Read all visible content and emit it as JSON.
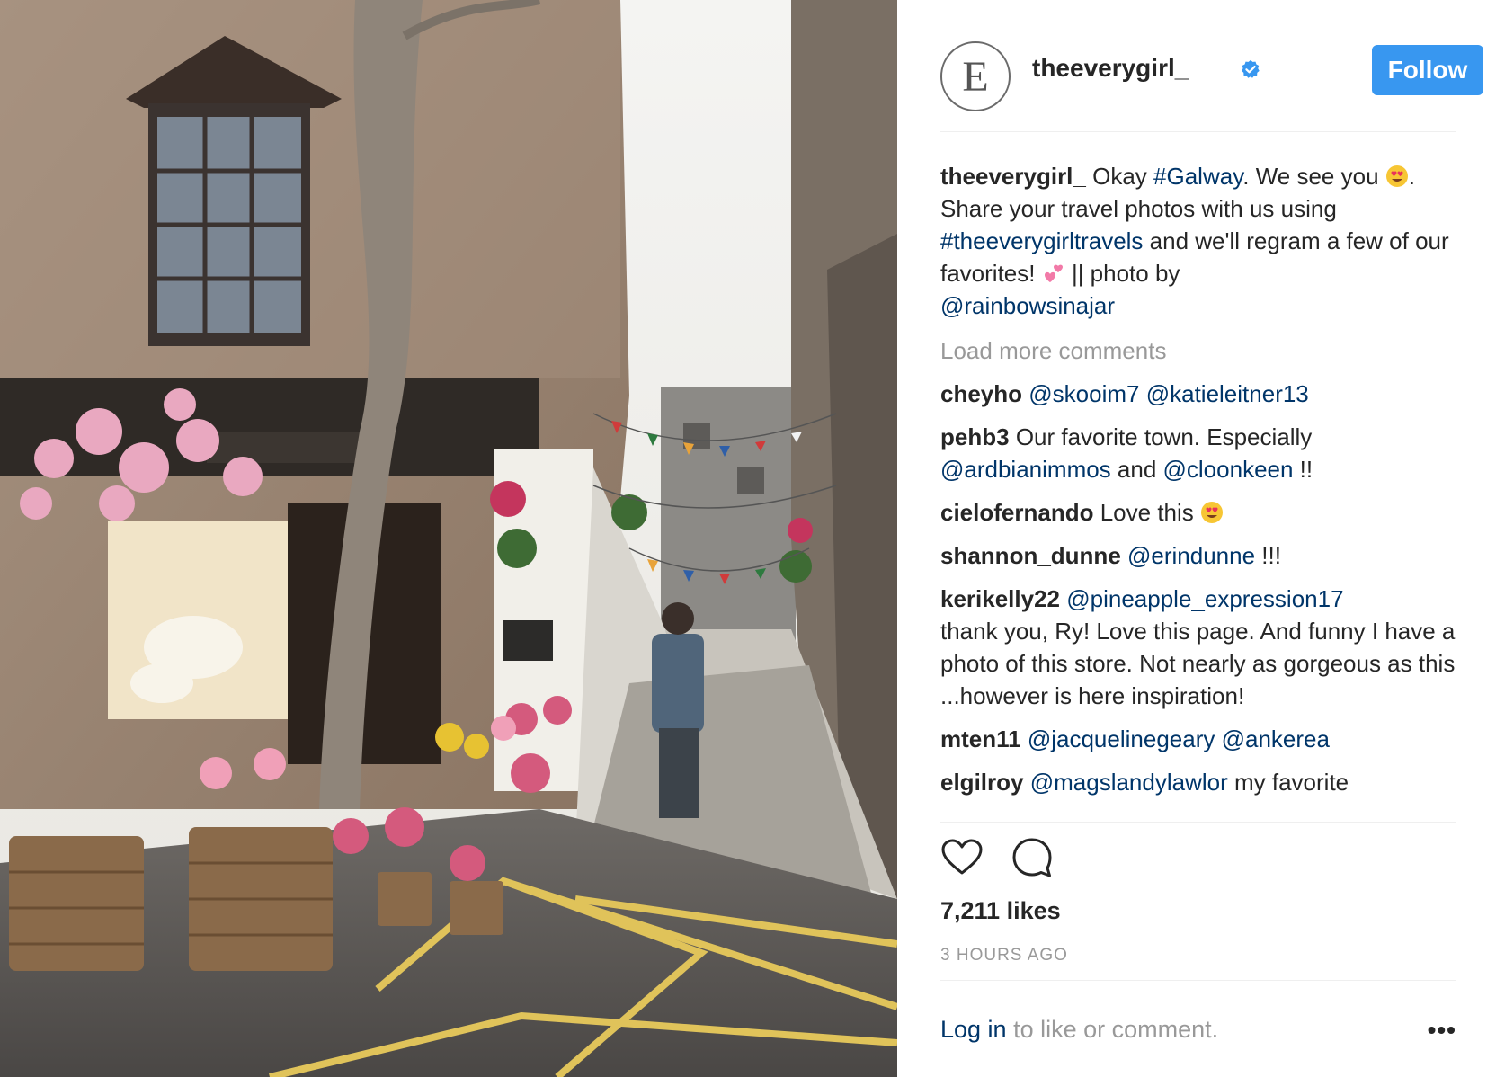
{
  "post": {
    "username": "theeverygirl_",
    "avatar_letter": "E",
    "follow_label": "Follow",
    "caption": {
      "user": "theeverygirl_",
      "parts": [
        "Okay ",
        "#Galway",
        ". We see you ",
        ". Share your travel photos with us using ",
        "#theeverygirltravels",
        " and we'll regram a few of our favorites! ",
        " || photo by ",
        "@rainbowsinajar"
      ]
    },
    "load_more": "Load more comments",
    "comments": [
      {
        "user": "cheyho",
        "tags": [
          "@skooim7",
          "@katieleitner13"
        ]
      },
      {
        "user": "pehb3",
        "text1": "Our favorite town. Especially ",
        "tag1": "@ardbianimmos",
        "text2": " and ",
        "tag2": "@cloonkeen",
        "text3": " !!"
      },
      {
        "user": "cielofernando",
        "text": "Love this "
      },
      {
        "user": "shannon_dunne",
        "tag": "@erindunne",
        "text": " !!!"
      },
      {
        "user": "kerikelly22",
        "tag": "@pineapple_expression17",
        "text": "thank you, Ry! Love this page. And funny I have a photo of this store. Not nearly as gorgeous as this ...however is here inspiration!"
      },
      {
        "user": "mten11",
        "tags": [
          "@jacquelinegeary",
          "@ankerea"
        ]
      },
      {
        "user": "elgilroy",
        "tag": "@magslandylawlor",
        "text": " my favorite"
      }
    ],
    "likes": "7,211 likes",
    "time": "3 HOURS AGO",
    "footer": {
      "login": "Log in",
      "rest": " to like or comment.",
      "more": "•••"
    },
    "icons": {
      "like": "heart-icon",
      "comment": "comment-bubble-icon",
      "verified": "verified-badge-icon",
      "emoji_love": "heart-eyes-emoji",
      "emoji_hearts": "two-hearts-emoji"
    },
    "colors": {
      "follow": "#3897f0",
      "link": "#003569",
      "muted": "#999999"
    }
  }
}
